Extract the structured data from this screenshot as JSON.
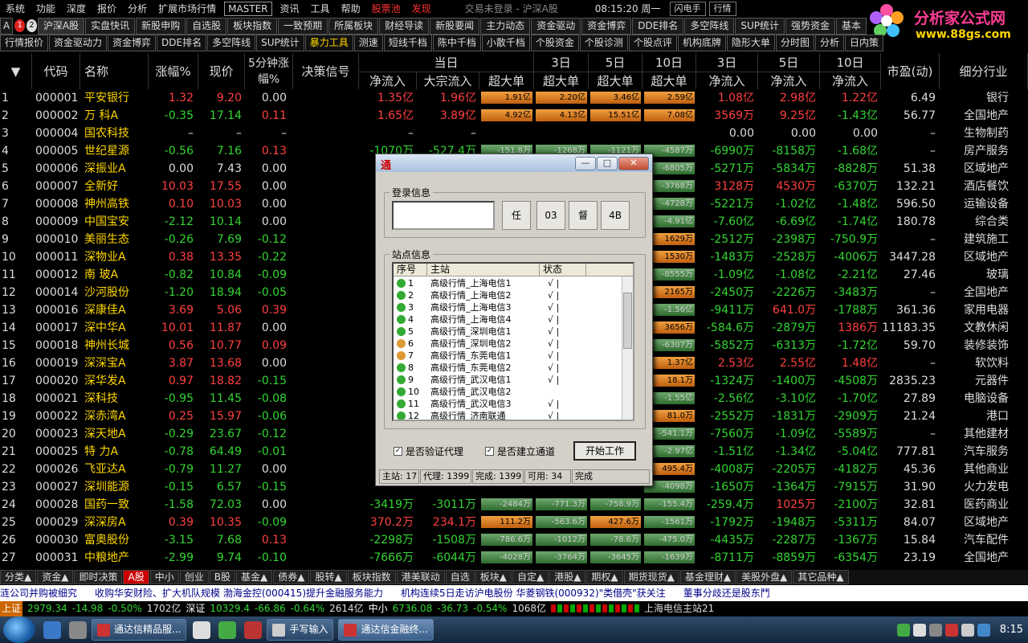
{
  "menu": {
    "items": [
      "系统",
      "功能",
      "深度",
      "报价",
      "分析",
      "扩展市场行情",
      "MASTER",
      "资讯",
      "工具",
      "帮助",
      "股票池",
      "发现"
    ],
    "title": "交易未登录 - 沪深A股",
    "clock": "08:15:20 周一",
    "btn_flash": "闪电手",
    "btn_quote": "行情"
  },
  "logo": {
    "text1": "分析家公式网",
    "text2": "www.88gs.com"
  },
  "tabs1": {
    "a": "A",
    "n1": "1",
    "n2": "2",
    "items": [
      "沪深A股",
      "实盘快讯",
      "新股申购",
      "自选股",
      "板块指数",
      "一致预期",
      "所属板块",
      "财经导读",
      "新股要闻",
      "主力动态",
      "资金驱动",
      "资金博弈",
      "DDE排名",
      "多空阵线",
      "SUP统计",
      "强势资金",
      "基本"
    ]
  },
  "tabs2": {
    "items": [
      "行情报价",
      "资金驱动力",
      "资金博弈",
      "DDE排名",
      "多空阵线",
      "SUP统计",
      "暴力工具",
      "测速",
      "短线千档",
      "陈中千档",
      "小散千档",
      "个股资金",
      "个股诊测",
      "个股点评",
      "机构底牌",
      "隐形大单",
      "分时图",
      "分析",
      "日内策"
    ]
  },
  "header": {
    "sort": "▼",
    "code": "代码",
    "name": "名称",
    "chg": "涨幅%",
    "price": "现价",
    "chg5": "5分钟涨幅%",
    "signal": "决策信号",
    "g_today": "当日",
    "g_3": "3日",
    "g_5": "5日",
    "g_10": "10日",
    "g_3b": "3日",
    "g_5b": "5日",
    "g_10b": "10日",
    "netin": "净流入",
    "block": "大宗流入",
    "super": "超大单",
    "super3": "超大单",
    "super5": "超大单",
    "super10": "超大单",
    "net3": "净流入",
    "net5": "净流入",
    "net10": "净流入",
    "pe": "市盈(动)",
    "ind": "细分行业"
  },
  "rows": [
    [
      "1",
      "000001",
      "平安银行",
      "1.32",
      "9.20",
      "0.00",
      "1.35亿",
      "1.96亿",
      "1.91亿",
      "2.20亿",
      "3.46亿",
      "2.59亿",
      "1.08亿",
      "2.98亿",
      "1.22亿",
      "6.49",
      "银行"
    ],
    [
      "2",
      "000002",
      "万 科A",
      "-0.35",
      "17.14",
      "0.11",
      "1.65亿",
      "3.89亿",
      "4.92亿",
      "4.13亿",
      "15.51亿",
      "7.08亿",
      "3569万",
      "9.25亿",
      "-1.43亿",
      "56.77",
      "全国地产"
    ],
    [
      "3",
      "000004",
      "国农科技",
      "–",
      "–",
      "–",
      "–",
      "–",
      "",
      "",
      "",
      "",
      "0.00",
      "0.00",
      "0.00",
      "–",
      "生物制药"
    ],
    [
      "4",
      "000005",
      "世纪星源",
      "-0.56",
      "7.16",
      "0.13",
      "-1070万",
      "-527.4万",
      "-151.8万",
      "-1268万",
      "-1121万",
      "-4587万",
      "-6990万",
      "-8158万",
      "-1.68亿",
      "–",
      "房产服务"
    ],
    [
      "5",
      "000006",
      "深振业A",
      "0.00",
      "7.43",
      "0.00",
      "",
      "",
      "",
      "",
      "",
      "-6805万",
      "-5271万",
      "-5834万",
      "-8828万",
      "51.38",
      "区域地产"
    ],
    [
      "6",
      "000007",
      "全新好",
      "10.03",
      "17.55",
      "0.00",
      "",
      "",
      "",
      "",
      "",
      "-3768万",
      "3128万",
      "4530万",
      "-6370万",
      "132.21",
      "酒店餐饮"
    ],
    [
      "7",
      "000008",
      "神州高铁",
      "0.10",
      "10.03",
      "0.00",
      "",
      "",
      "",
      "",
      "",
      "-4728万",
      "-5221万",
      "-1.02亿",
      "-1.48亿",
      "596.50",
      "运输设备"
    ],
    [
      "8",
      "000009",
      "中国宝安",
      "-2.12",
      "10.14",
      "0.00",
      "",
      "",
      "",
      "",
      "",
      "-4.91亿",
      "-7.60亿",
      "-6.69亿",
      "-1.74亿",
      "180.78",
      "综合类"
    ],
    [
      "9",
      "000010",
      "美丽生态",
      "-0.26",
      "7.69",
      "-0.12",
      "",
      "",
      "",
      "",
      "",
      "1629万",
      "-2512万",
      "-2398万",
      "-750.9万",
      "–",
      "建筑施工"
    ],
    [
      "10",
      "000011",
      "深物业A",
      "0.38",
      "13.35",
      "-0.22",
      "",
      "",
      "",
      "",
      "",
      "1530万",
      "-1483万",
      "-2528万",
      "-4006万",
      "3447.28",
      "区域地产"
    ],
    [
      "11",
      "000012",
      "南 玻A",
      "-0.82",
      "10.84",
      "-0.09",
      "",
      "",
      "",
      "",
      "",
      "-8555万",
      "-1.09亿",
      "-1.08亿",
      "-2.21亿",
      "27.46",
      "玻璃"
    ],
    [
      "12",
      "000014",
      "沙河股份",
      "-1.20",
      "18.94",
      "-0.05",
      "",
      "",
      "",
      "",
      "",
      "2165万",
      "-2450万",
      "-2226万",
      "-3483万",
      "–",
      "全国地产"
    ],
    [
      "13",
      "000016",
      "深康佳A",
      "3.69",
      "5.06",
      "0.39",
      "",
      "",
      "",
      "",
      "",
      "-1.56亿",
      "-9411万",
      "641.0万",
      "-1788万",
      "361.36",
      "家用电器"
    ],
    [
      "14",
      "000017",
      "深中华A",
      "10.01",
      "11.87",
      "0.00",
      "",
      "",
      "",
      "",
      "",
      "3656万",
      "-584.6万",
      "-2879万",
      "1386万",
      "11183.35",
      "文教休闲"
    ],
    [
      "15",
      "000018",
      "神州长城",
      "0.56",
      "10.77",
      "0.09",
      "",
      "",
      "",
      "",
      "",
      "-6307万",
      "-5852万",
      "-6313万",
      "-1.72亿",
      "59.70",
      "装修装饰"
    ],
    [
      "16",
      "000019",
      "深深宝A",
      "3.87",
      "13.68",
      "0.00",
      "",
      "",
      "",
      "",
      "",
      "1.37亿",
      "2.53亿",
      "2.55亿",
      "1.48亿",
      "–",
      "软饮料"
    ],
    [
      "17",
      "000020",
      "深华发A",
      "0.97",
      "18.82",
      "-0.15",
      "",
      "",
      "",
      "",
      "",
      "18.1万",
      "-1324万",
      "-1400万",
      "-4508万",
      "2835.23",
      "元器件"
    ],
    [
      "18",
      "000021",
      "深科技",
      "-0.95",
      "11.45",
      "-0.08",
      "",
      "",
      "",
      "",
      "",
      "-1.55亿",
      "-2.56亿",
      "-3.10亿",
      "-1.70亿",
      "27.89",
      "电脑设备"
    ],
    [
      "19",
      "000022",
      "深赤湾A",
      "0.25",
      "15.97",
      "-0.06",
      "",
      "",
      "",
      "",
      "",
      "81.0万",
      "-2552万",
      "-1831万",
      "-2909万",
      "21.24",
      "港口"
    ],
    [
      "20",
      "000023",
      "深天地A",
      "-0.29",
      "23.67",
      "-0.12",
      "",
      "",
      "",
      "",
      "",
      "-541.1万",
      "-7560万",
      "-1.09亿",
      "-5589万",
      "–",
      "其他建材"
    ],
    [
      "21",
      "000025",
      "特 力A",
      "-0.78",
      "64.49",
      "-0.01",
      "",
      "",
      "",
      "",
      "",
      "-2.97亿",
      "-1.51亿",
      "-1.34亿",
      "-5.04亿",
      "777.81",
      "汽车服务"
    ],
    [
      "22",
      "000026",
      "飞亚达A",
      "-0.79",
      "11.27",
      "0.00",
      "",
      "",
      "",
      "",
      "",
      "495.4万",
      "-4008万",
      "-2205万",
      "-4182万",
      "45.36",
      "其他商业"
    ],
    [
      "23",
      "000027",
      "深圳能源",
      "-0.15",
      "6.57",
      "-0.15",
      "",
      "",
      "",
      "",
      "",
      "-4098万",
      "-1650万",
      "-1364万",
      "-7915万",
      "31.90",
      "火力发电"
    ],
    [
      "24",
      "000028",
      "国药一致",
      "-1.58",
      "72.03",
      "0.00",
      "-3419万",
      "-3011万",
      "-2484万",
      "-771.3万",
      "-758.9万",
      "-155.4万",
      "-259.4万",
      "1025万",
      "-2100万",
      "32.81",
      "医药商业"
    ],
    [
      "25",
      "000029",
      "深深房A",
      "0.39",
      "10.35",
      "-0.09",
      "370.2万",
      "234.1万",
      "111.2万",
      "-563.6万",
      "427.6万",
      "-1561万",
      "-1792万",
      "-1948万",
      "-5311万",
      "84.07",
      "区域地产"
    ],
    [
      "26",
      "000030",
      "富奥股份",
      "-3.15",
      "7.68",
      "0.13",
      "-2298万",
      "-1508万",
      "-786.6万",
      "-1012万",
      "-78.6万",
      "-475.0万",
      "-4435万",
      "-2287万",
      "-1367万",
      "15.84",
      "汽车配件"
    ],
    [
      "27",
      "000031",
      "中粮地产",
      "-2.99",
      "9.74",
      "-0.10",
      "-7666万",
      "-6044万",
      "-4028万",
      "-3764万",
      "-3645万",
      "-1639万",
      "-8711万",
      "-8859万",
      "-6354万",
      "23.19",
      "全国地产"
    ]
  ],
  "bottom_tabs": [
    "分类▲",
    "资金▲",
    "即时决策",
    "A股",
    "中小",
    "创业",
    "B股",
    "基金▲",
    "债券▲",
    "股转▲",
    "板块指数",
    "港美联动",
    "自选",
    "板块▲",
    "自定▲",
    "港股▲",
    "期权▲",
    "期货现货▲",
    "基金理财▲",
    "美股外盘▲",
    "其它品种▲"
  ],
  "ticker": [
    "涟公司并购被细究",
    "收购华安财险、扩大机队规模 渤海金控(000415)提升金融服务能力",
    "机构连续5日走访沪电股份 华菱钢铁(000932)\"类借壳\"获关注",
    "董事分歧还是股东鬥"
  ],
  "status": {
    "sh": "上证",
    "sh_v": "2979.34",
    "sh_c": "-14.98",
    "sh_p": "-0.50%",
    "sh_a": "1702亿",
    "sz": "深证",
    "sz_v": "10329.4",
    "sz_c": "-66.86",
    "sz_p": "-0.64%",
    "sz_a": "2614亿",
    "zx": "中小",
    "zx_v": "6736.08",
    "zx_c": "-36.73",
    "zx_p": "-0.54%",
    "zx_a": "1068亿",
    "server": "上海电信主站21"
  },
  "dialog": {
    "title": "",
    "group_login": "登录信息",
    "btn1": "任",
    "btn2": "03",
    "btn3": "督",
    "btn4": "4B",
    "group_site": "站点信息",
    "col_no": "序号",
    "col_site": "主站",
    "col_state": "状态",
    "sites": [
      {
        "n": "1",
        "s": "高级行情_上海电信1",
        "st": "√ |",
        "c": "#3a3"
      },
      {
        "n": "2",
        "s": "高级行情_上海电信2",
        "st": "√ |",
        "c": "#3a3"
      },
      {
        "n": "3",
        "s": "高级行情_上海电信3",
        "st": "√ |",
        "c": "#3a3"
      },
      {
        "n": "4",
        "s": "高级行情_上海电信4",
        "st": "√ |",
        "c": "#3a3"
      },
      {
        "n": "5",
        "s": "高级行情_深圳电信1",
        "st": "√ |",
        "c": "#3a3"
      },
      {
        "n": "6",
        "s": "高级行情_深圳电信2",
        "st": "√ |",
        "c": "#d93"
      },
      {
        "n": "7",
        "s": "高级行情_东莞电信1",
        "st": "√ |",
        "c": "#d93"
      },
      {
        "n": "8",
        "s": "高级行情_东莞电信2",
        "st": "√ |",
        "c": "#3a3"
      },
      {
        "n": "9",
        "s": "高级行情_武汉电信1",
        "st": "√ |",
        "c": "#3a3"
      },
      {
        "n": "10",
        "s": "高级行情_武汉电信2",
        "st": "",
        "c": "#3a3"
      },
      {
        "n": "11",
        "s": "高级行情_武汉电信3",
        "st": "√ |",
        "c": "#3a3"
      },
      {
        "n": "12",
        "s": "高级行情_济南联通",
        "st": "√ |",
        "c": "#3a3"
      }
    ],
    "chk1": "是否验证代理",
    "chk2": "是否建立通道",
    "start": "开始工作",
    "st1": "主站: 17",
    "st2": "代理: 1399",
    "st3": "完成: 1399",
    "st4": "可用: 34",
    "st5": "完成"
  },
  "taskbar": {
    "t1": "通达信精品服...",
    "t2": "手写输入",
    "t3": "通达信金融终...",
    "time": "8:15"
  },
  "colors": {
    "up": "#ff4040",
    "down": "#33d533",
    "accent": "#ffd700",
    "bar_orange": "#e07a20",
    "bar_green": "#4a8a4a"
  }
}
